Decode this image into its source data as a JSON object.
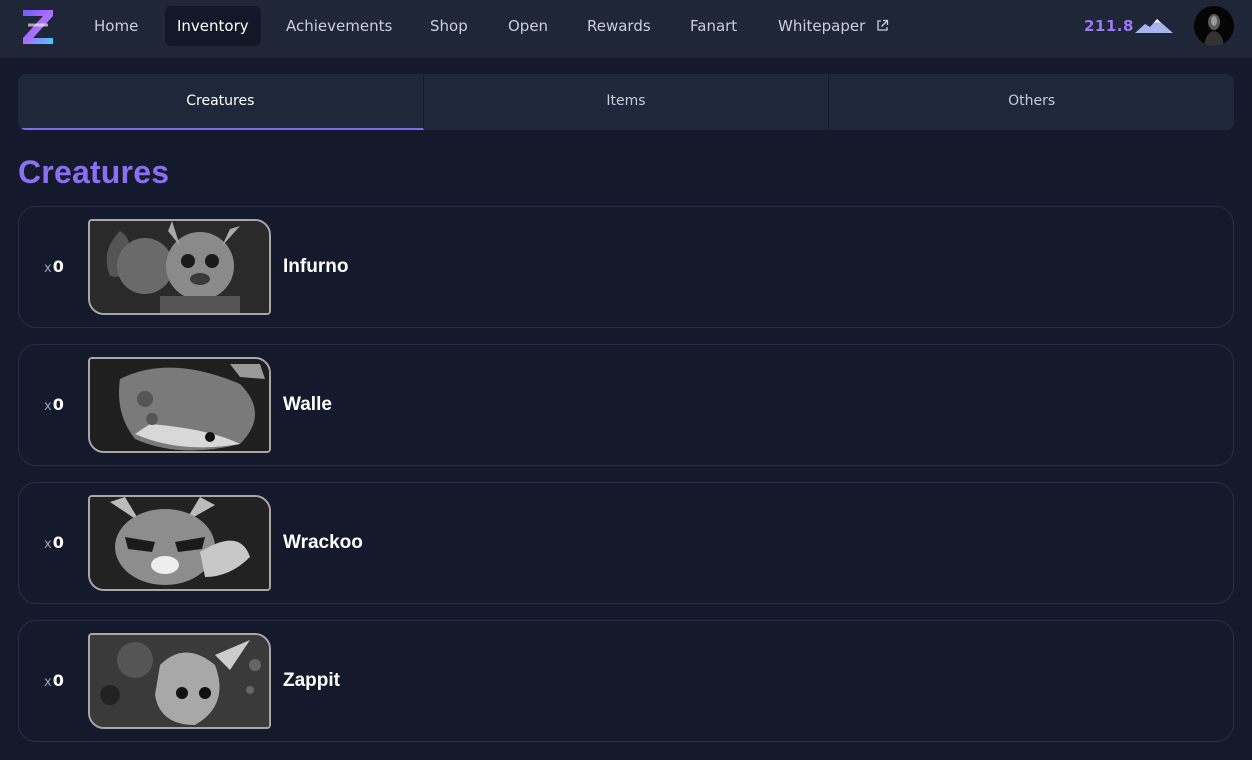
{
  "nav": {
    "items": [
      {
        "label": "Home",
        "active": false
      },
      {
        "label": "Inventory",
        "active": true
      },
      {
        "label": "Achievements",
        "active": false
      },
      {
        "label": "Shop",
        "active": false
      },
      {
        "label": "Open",
        "active": false
      },
      {
        "label": "Rewards",
        "active": false
      },
      {
        "label": "Fanart",
        "active": false
      },
      {
        "label": "Whitepaper",
        "active": false,
        "external": true
      }
    ]
  },
  "balance": {
    "value": "211.8",
    "icon": "mountain-icon"
  },
  "tabs": [
    {
      "label": "Creatures",
      "active": true
    },
    {
      "label": "Items",
      "active": false
    },
    {
      "label": "Others",
      "active": false
    }
  ],
  "section": {
    "title": "Creatures"
  },
  "creatures": [
    {
      "name": "Infurno",
      "count_prefix": "x",
      "count": "0"
    },
    {
      "name": "Walle",
      "count_prefix": "x",
      "count": "0"
    },
    {
      "name": "Wrackoo",
      "count_prefix": "x",
      "count": "0"
    },
    {
      "name": "Zappit",
      "count_prefix": "x",
      "count": "0"
    }
  ],
  "colors": {
    "accent": "#8b6ff0",
    "background": "#141a2b",
    "topbar": "#1e2638"
  }
}
